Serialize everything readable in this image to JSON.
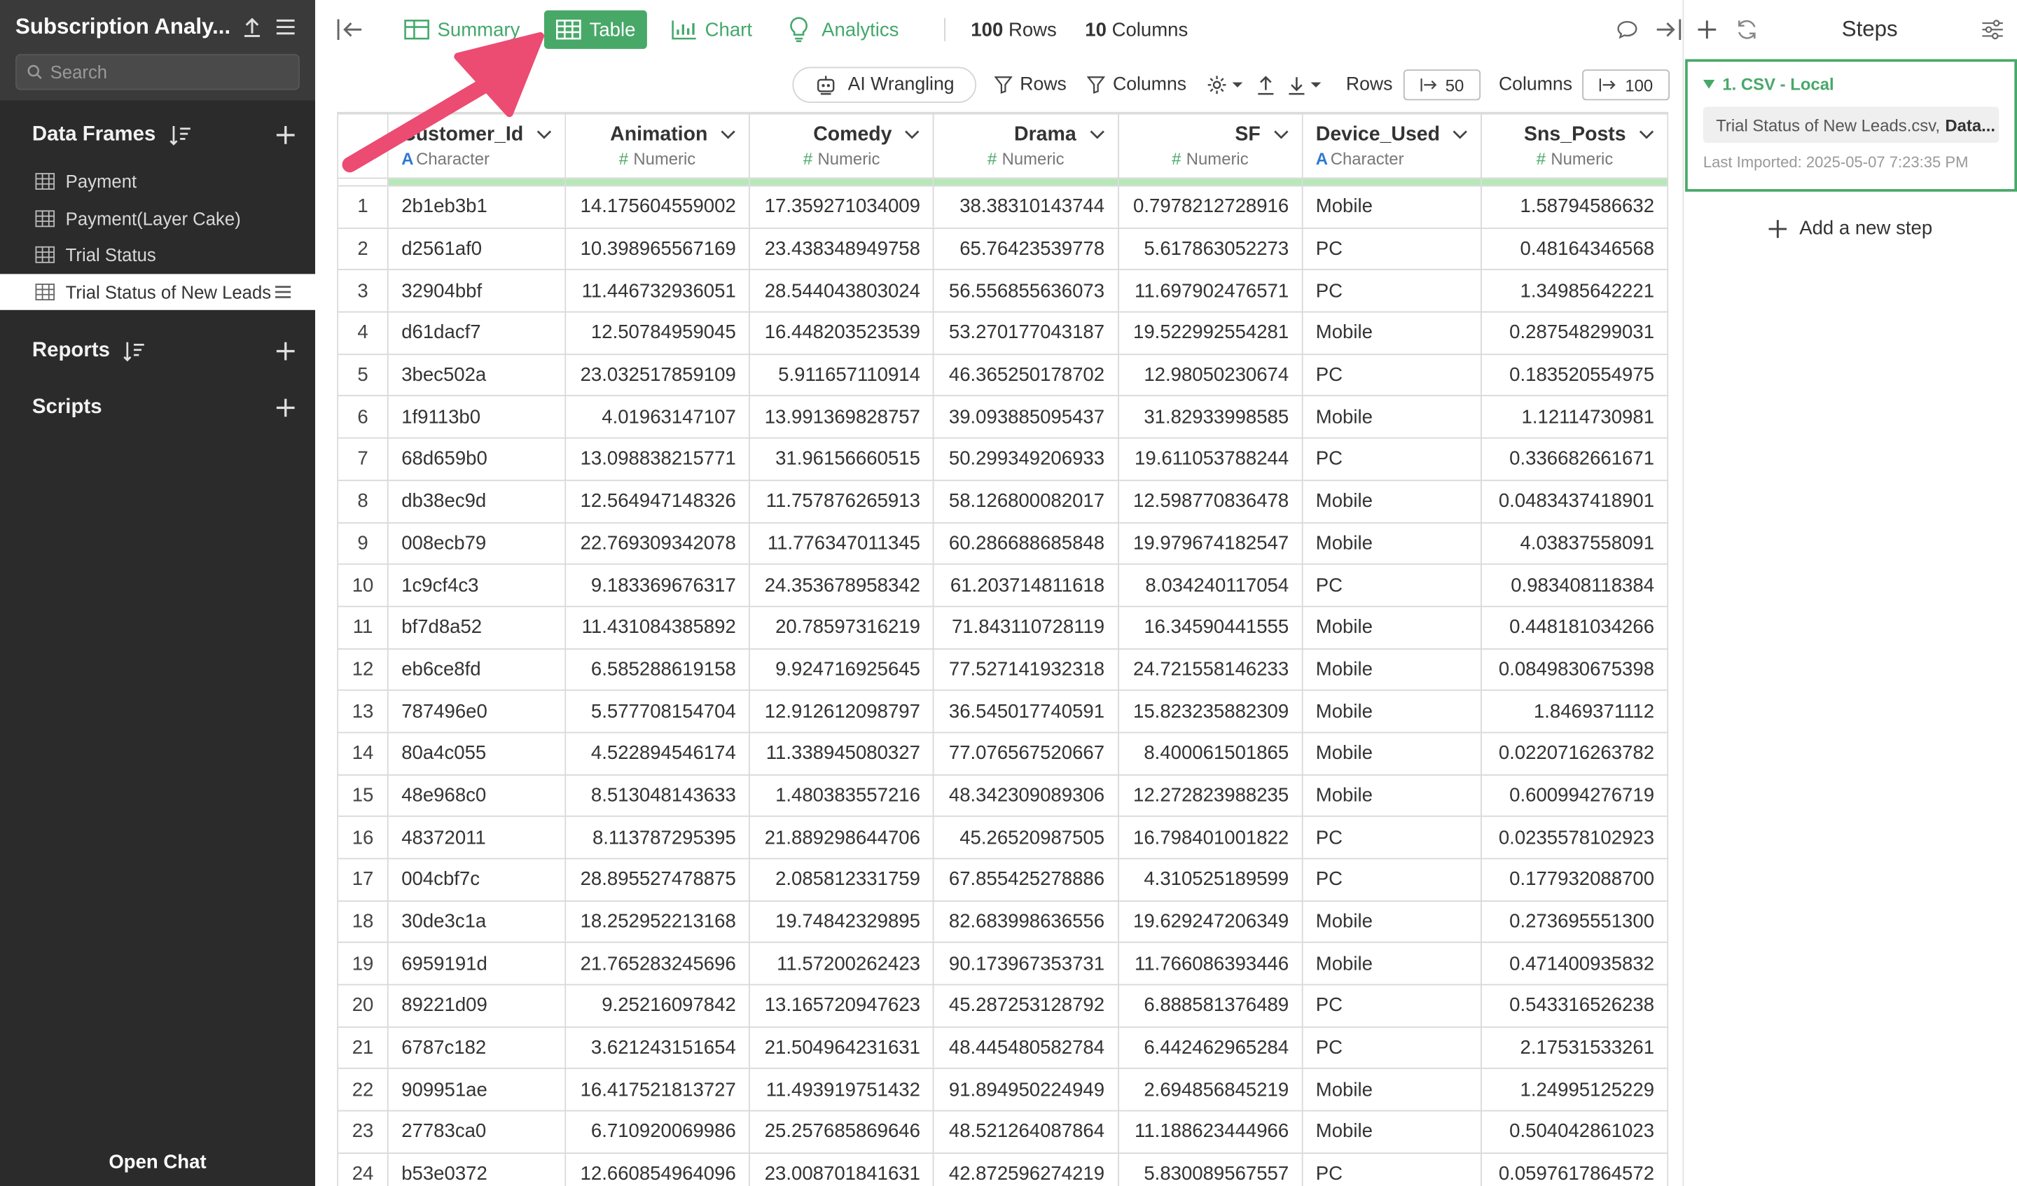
{
  "sidebar": {
    "project_title": "Subscription Analy...",
    "search_placeholder": "Search",
    "sections": {
      "data_frames": "Data Frames",
      "reports": "Reports",
      "scripts": "Scripts"
    },
    "data_frames": [
      "Payment",
      "Payment(Layer Cake)",
      "Trial Status",
      "Trial Status of New Leads"
    ],
    "open_chat": "Open Chat"
  },
  "toolbar": {
    "tabs": [
      "Summary",
      "Table",
      "Chart",
      "Analytics"
    ],
    "active_tab": "Table",
    "rows_count": "100",
    "rows_label": "Rows",
    "cols_count": "10",
    "cols_label": "Columns"
  },
  "toolbar2": {
    "ai_wrangling": "AI Wrangling",
    "rows_filter": "Rows",
    "columns_filter": "Columns",
    "rows_label": "Rows",
    "rows_limit": "50",
    "columns_label": "Columns",
    "columns_limit": "100"
  },
  "table": {
    "columns": [
      {
        "name": "Customer_Id",
        "type": "Character",
        "type_glyph": "A"
      },
      {
        "name": "Animation",
        "type": "Numeric",
        "type_glyph": "#"
      },
      {
        "name": "Comedy",
        "type": "Numeric",
        "type_glyph": "#"
      },
      {
        "name": "Drama",
        "type": "Numeric",
        "type_glyph": "#"
      },
      {
        "name": "SF",
        "type": "Numeric",
        "type_glyph": "#"
      },
      {
        "name": "Device_Used",
        "type": "Character",
        "type_glyph": "A"
      },
      {
        "name": "Sns_Posts",
        "type": "Numeric",
        "type_glyph": "#"
      }
    ],
    "rows": [
      [
        "1",
        "2b1eb3b1",
        "14.175604559002",
        "17.359271034009",
        "38.38310143744",
        "0.7978212728916",
        "Mobile",
        "1.58794586632"
      ],
      [
        "2",
        "d2561af0",
        "10.398965567169",
        "23.438348949758",
        "65.76423539778",
        "5.617863052273",
        "PC",
        "0.48164346568"
      ],
      [
        "3",
        "32904bbf",
        "11.446732936051",
        "28.544043803024",
        "56.556855636073",
        "11.697902476571",
        "PC",
        "1.34985642221"
      ],
      [
        "4",
        "d61dacf7",
        "12.50784959045",
        "16.448203523539",
        "53.270177043187",
        "19.522992554281",
        "Mobile",
        "0.287548299031"
      ],
      [
        "5",
        "3bec502a",
        "23.032517859109",
        "5.911657110914",
        "46.365250178702",
        "12.98050230674",
        "PC",
        "0.183520554975"
      ],
      [
        "6",
        "1f9113b0",
        "4.01963147107",
        "13.991369828757",
        "39.093885095437",
        "31.82933998585",
        "Mobile",
        "1.12114730981"
      ],
      [
        "7",
        "68d659b0",
        "13.098838215771",
        "31.96156660515",
        "50.299349206933",
        "19.611053788244",
        "PC",
        "0.336682661671"
      ],
      [
        "8",
        "db38ec9d",
        "12.564947148326",
        "11.757876265913",
        "58.126800082017",
        "12.598770836478",
        "Mobile",
        "0.0483437418901"
      ],
      [
        "9",
        "008ecb79",
        "22.769309342078",
        "11.776347011345",
        "60.286688685848",
        "19.979674182547",
        "Mobile",
        "4.03837558091"
      ],
      [
        "10",
        "1c9cf4c3",
        "9.183369676317",
        "24.353678958342",
        "61.203714811618",
        "8.034240117054",
        "PC",
        "0.983408118384"
      ],
      [
        "11",
        "bf7d8a52",
        "11.431084385892",
        "20.78597316219",
        "71.843110728119",
        "16.34590441555",
        "Mobile",
        "0.448181034266"
      ],
      [
        "12",
        "eb6ce8fd",
        "6.585288619158",
        "9.924716925645",
        "77.527141932318",
        "24.721558146233",
        "Mobile",
        "0.0849830675398"
      ],
      [
        "13",
        "787496e0",
        "5.577708154704",
        "12.912612098797",
        "36.545017740591",
        "15.823235882309",
        "Mobile",
        "1.8469371112"
      ],
      [
        "14",
        "80a4c055",
        "4.522894546174",
        "11.338945080327",
        "77.076567520667",
        "8.400061501865",
        "Mobile",
        "0.0220716263782"
      ],
      [
        "15",
        "48e968c0",
        "8.513048143633",
        "1.480383557216",
        "48.342309089306",
        "12.272823988235",
        "Mobile",
        "0.600994276719"
      ],
      [
        "16",
        "48372011",
        "8.113787295395",
        "21.889298644706",
        "45.26520987505",
        "16.798401001822",
        "PC",
        "0.0235578102923"
      ],
      [
        "17",
        "004cbf7c",
        "28.895527478875",
        "2.085812331759",
        "67.855425278886",
        "4.310525189599",
        "PC",
        "0.177932088700"
      ],
      [
        "18",
        "30de3c1a",
        "18.252952213168",
        "19.74842329895",
        "82.683998636556",
        "19.629247206349",
        "Mobile",
        "0.273695551300"
      ],
      [
        "19",
        "6959191d",
        "21.765283245696",
        "11.57200262423",
        "90.173967353731",
        "11.766086393446",
        "Mobile",
        "0.471400935832"
      ],
      [
        "20",
        "89221d09",
        "9.25216097842",
        "13.165720947623",
        "45.287253128792",
        "6.888581376489",
        "PC",
        "0.543316526238"
      ],
      [
        "21",
        "6787c182",
        "3.621243151654",
        "21.504964231631",
        "48.445480582784",
        "6.442462965284",
        "PC",
        "2.17531533261"
      ],
      [
        "22",
        "909951ae",
        "16.417521813727",
        "11.493919751432",
        "91.894950224949",
        "2.694856845219",
        "Mobile",
        "1.24995125229"
      ],
      [
        "23",
        "27783ca0",
        "6.710920069986",
        "25.257685869646",
        "48.521264087864",
        "11.188623444966",
        "Mobile",
        "0.504042861023"
      ],
      [
        "24",
        "b53e0372",
        "12.660854964096",
        "23.008701841631",
        "42.872596274219",
        "5.830089567557",
        "PC",
        "0.0597617864572"
      ]
    ]
  },
  "steps_panel": {
    "title": "Steps",
    "step_name": "1. CSV - Local",
    "file_name": "Trial Status of New Leads.csv,",
    "file_suffix": "Data...",
    "last_imported": "Last Imported: 2025-05-07 7:23:35 PM",
    "add_step": "Add a new step"
  },
  "colors": {
    "accent_green": "#48a868",
    "sidebar_bg": "#2b2b2b",
    "annotation_arrow": "#ec4b72",
    "character_type": "#2e78d2"
  }
}
